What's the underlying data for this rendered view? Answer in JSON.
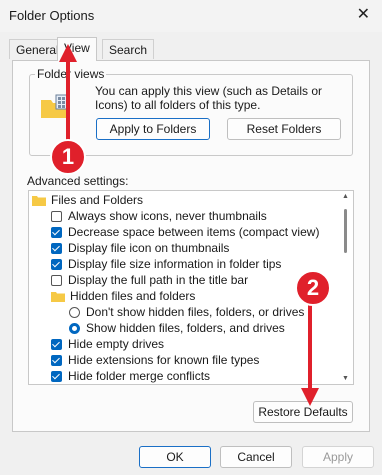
{
  "window": {
    "title": "Folder Options",
    "close_glyph": "✕"
  },
  "tabs": [
    {
      "label": "General"
    },
    {
      "label": "View"
    },
    {
      "label": "Search"
    }
  ],
  "folder_views": {
    "label": "Folder views",
    "description": "You can apply this view (such as Details or Icons) to all folders of this type.",
    "apply_button": "Apply to Folders",
    "reset_button": "Reset Folders"
  },
  "advanced": {
    "label": "Advanced settings:",
    "items": [
      {
        "type": "folder",
        "label": "Files and Folders"
      },
      {
        "type": "checkbox",
        "checked": false,
        "label": "Always show icons, never thumbnails"
      },
      {
        "type": "checkbox",
        "checked": true,
        "label": "Decrease space between items (compact view)"
      },
      {
        "type": "checkbox",
        "checked": true,
        "label": "Display file icon on thumbnails"
      },
      {
        "type": "checkbox",
        "checked": true,
        "label": "Display file size information in folder tips"
      },
      {
        "type": "checkbox",
        "checked": false,
        "label": "Display the full path in the title bar"
      },
      {
        "type": "folder",
        "label": "Hidden files and folders"
      },
      {
        "type": "radio",
        "checked": false,
        "label": "Don't show hidden files, folders, or drives"
      },
      {
        "type": "radio",
        "checked": true,
        "label": "Show hidden files, folders, and drives"
      },
      {
        "type": "checkbox",
        "checked": true,
        "label": "Hide empty drives"
      },
      {
        "type": "checkbox",
        "checked": true,
        "label": "Hide extensions for known file types"
      },
      {
        "type": "checkbox",
        "checked": true,
        "label": "Hide folder merge conflicts"
      }
    ],
    "restore_button": "Restore Defaults"
  },
  "footer": {
    "ok": "OK",
    "cancel": "Cancel",
    "apply": "Apply"
  },
  "annotations": [
    {
      "label": "1"
    },
    {
      "label": "2"
    }
  ],
  "colors": {
    "accent": "#0067c0",
    "callout": "#e0202b",
    "folder": "#f6c945"
  }
}
